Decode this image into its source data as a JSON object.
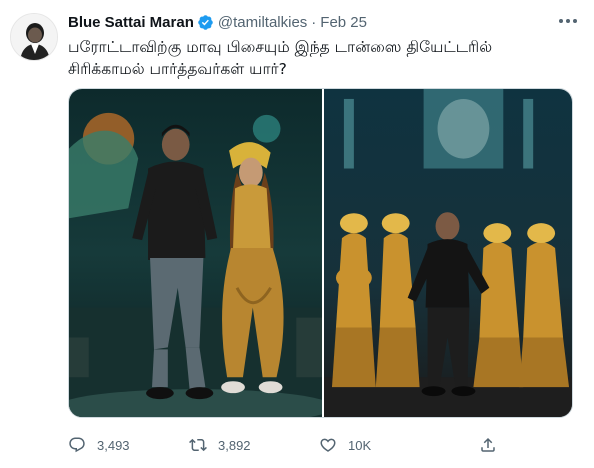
{
  "tweet": {
    "author": {
      "display_name": "Blue Sattai Maran",
      "handle": "@tamiltalkies",
      "verified": true,
      "avatar_icon": "profile-photo"
    },
    "separator": "·",
    "date": "Feb 25",
    "text_lines": [
      "பரோட்டாவிற்கு மாவு பிசையும் இந்த டான்ஸை தியேட்டரில்",
      "சிரிக்காமல் பார்த்தவர்கள் யார்?"
    ],
    "media_icons": [
      "dance-scene-photo",
      "group-dance-photo"
    ],
    "stats": {
      "replies": "3,493",
      "retweets": "3,892",
      "likes": "10K"
    },
    "colors": {
      "verified_blue": "#1d9bf0",
      "muted_text": "#536471",
      "main_text": "#0f1419"
    }
  }
}
